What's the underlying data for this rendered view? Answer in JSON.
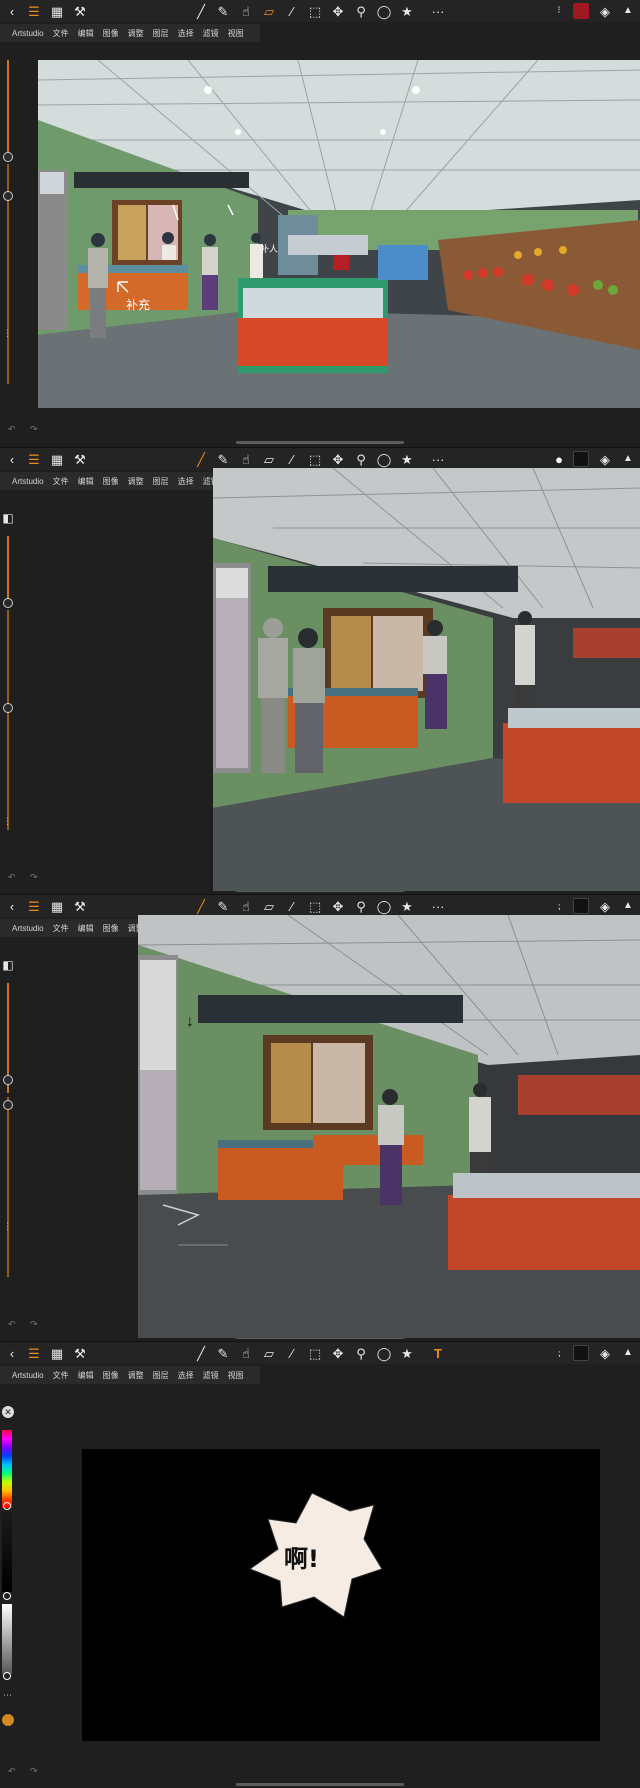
{
  "app": {
    "menu": [
      "Artstudio",
      "文件",
      "编辑",
      "图像",
      "调整",
      "图层",
      "选择",
      "滤镜",
      "视图"
    ]
  },
  "toolbar": {
    "back_icon": "chevron-left-icon",
    "menu_icon": "hamburger-icon",
    "gallery_icon": "grid-icon",
    "tools_icon": "wrench-icon",
    "more_label": "···",
    "more_label_short": "··"
  },
  "colors": {
    "accent": "#f08a1c",
    "primary_red": "#a01820",
    "primary_black": "#111111",
    "burst_fill": "#f6ece4"
  },
  "panels": [
    {
      "active_tool": "eraser-tool",
      "primary_color": "#a01820",
      "canvas_annotations": [
        "补充",
        "补人"
      ]
    },
    {
      "active_tool": "paintbrush-tool",
      "primary_color": "#111111"
    },
    {
      "active_tool": "paintbrush-tool",
      "primary_color": "#111111",
      "canvas_annotations": [
        "↓"
      ]
    },
    {
      "active_tool": "text-tool",
      "primary_color": "#111111",
      "burst_text": "啊!"
    }
  ]
}
